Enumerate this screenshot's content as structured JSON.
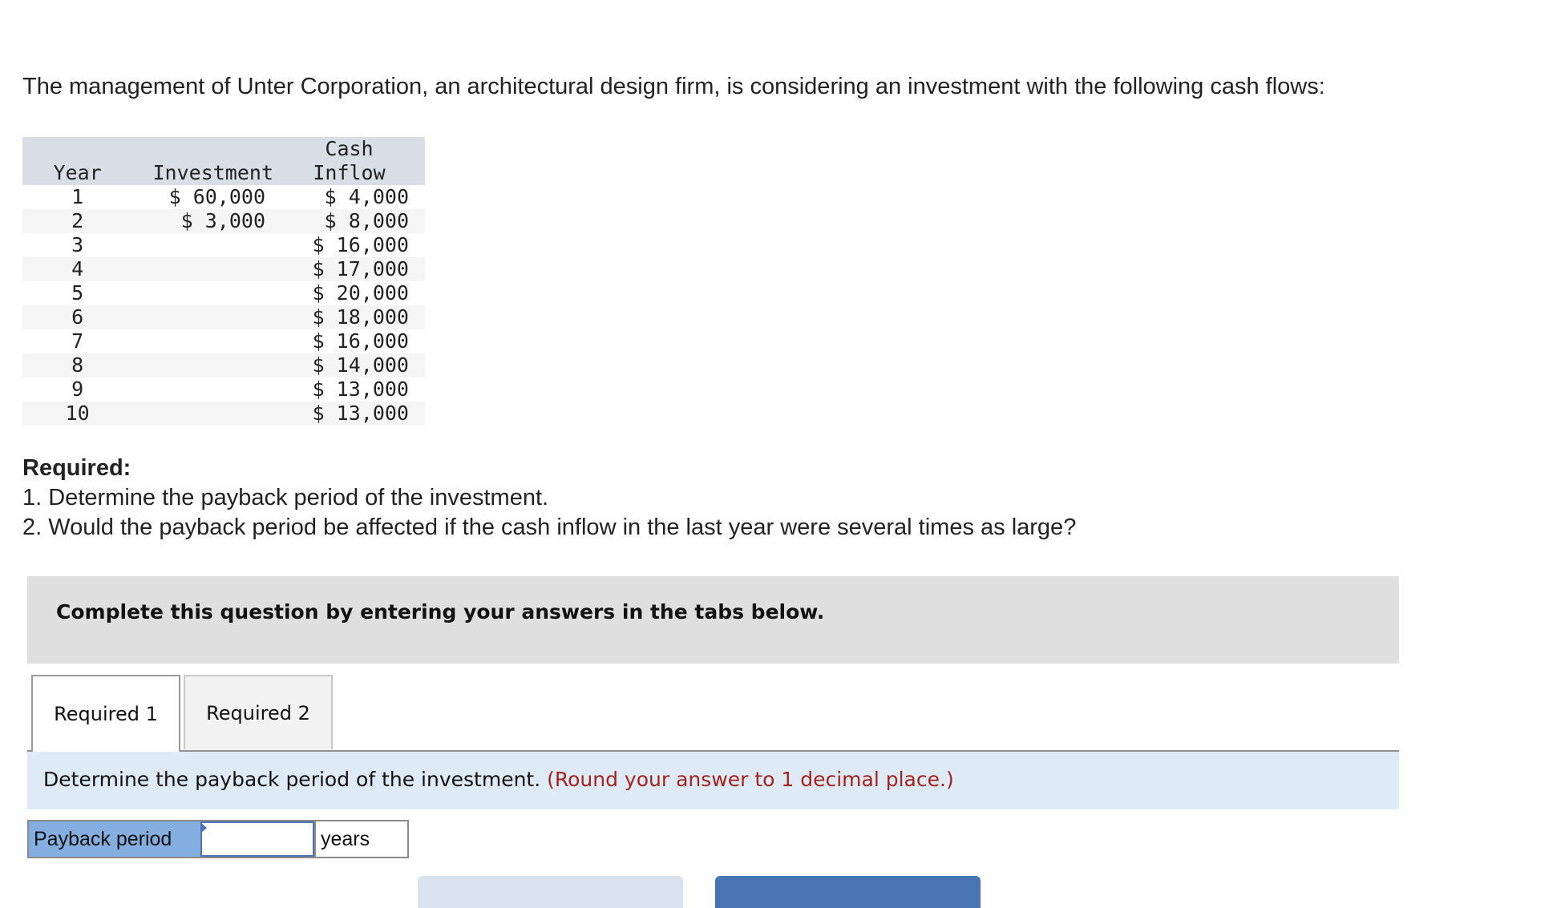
{
  "intro": "The management of Unter Corporation, an architectural design firm, is considering an investment with the following cash flows:",
  "table": {
    "headers": {
      "year": "Year",
      "investment": "Investment",
      "cash_inflow_line1": "Cash",
      "cash_inflow_line2": "Inflow"
    },
    "rows": [
      {
        "year": "1",
        "investment": "$ 60,000",
        "cash_inflow": "$ 4,000"
      },
      {
        "year": "2",
        "investment": "$ 3,000",
        "cash_inflow": "$ 8,000"
      },
      {
        "year": "3",
        "investment": "",
        "cash_inflow": "$ 16,000"
      },
      {
        "year": "4",
        "investment": "",
        "cash_inflow": "$ 17,000"
      },
      {
        "year": "5",
        "investment": "",
        "cash_inflow": "$ 20,000"
      },
      {
        "year": "6",
        "investment": "",
        "cash_inflow": "$ 18,000"
      },
      {
        "year": "7",
        "investment": "",
        "cash_inflow": "$ 16,000"
      },
      {
        "year": "8",
        "investment": "",
        "cash_inflow": "$ 14,000"
      },
      {
        "year": "9",
        "investment": "",
        "cash_inflow": "$ 13,000"
      },
      {
        "year": "10",
        "investment": "",
        "cash_inflow": "$ 13,000"
      }
    ]
  },
  "required": {
    "title": "Required:",
    "items": [
      "1. Determine the payback period of the investment.",
      "2. Would the payback period be affected if the cash inflow in the last year were several times as large?"
    ]
  },
  "instruction": "Complete this question by entering your answers in the tabs below.",
  "tabs": [
    {
      "label": "Required 1",
      "active": true
    },
    {
      "label": "Required 2",
      "active": false
    }
  ],
  "question": {
    "text": "Determine the payback period of the investment.",
    "hint": "(Round your answer to 1 decimal place.)"
  },
  "answer": {
    "label": "Payback period",
    "value": "",
    "unit": "years"
  },
  "colors": {
    "hint": "#a5211b",
    "answer_label_bg": "#84aee0",
    "question_bar_bg": "#deebf7",
    "next_button": "#4774b3",
    "prev_button": "#d9e2ee"
  }
}
